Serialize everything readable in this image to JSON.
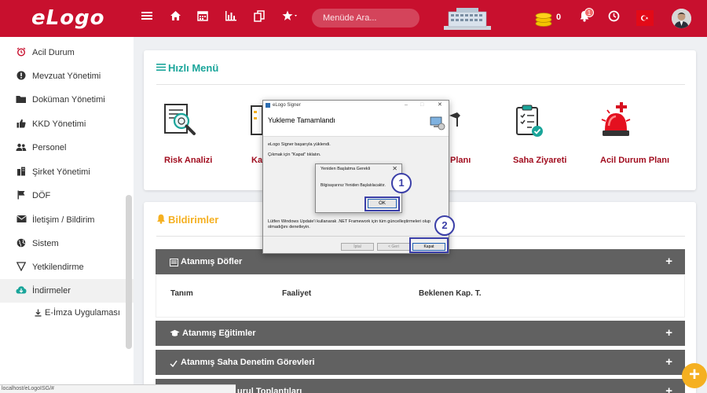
{
  "app": {
    "logo": "eLogo"
  },
  "topbar": {
    "search_placeholder": "Menüde Ara...",
    "coin_count": "0",
    "notification_badge": "1",
    "icons": [
      "menu-icon",
      "home-icon",
      "calendar-icon",
      "chart-icon",
      "copy-icon",
      "star-icon",
      "coins-icon",
      "bell-icon",
      "clock-icon",
      "flag-tr-icon",
      "user-avatar"
    ]
  },
  "sidebar": {
    "items": [
      {
        "label": "Acil Durum",
        "icon": "alarm-icon"
      },
      {
        "label": "Mevzuat Yönetimi",
        "icon": "exclamation-icon"
      },
      {
        "label": "Doküman Yönetimi",
        "icon": "folder-icon"
      },
      {
        "label": "KKD Yönetimi",
        "icon": "thumbs-up-icon"
      },
      {
        "label": "Personel",
        "icon": "users-icon"
      },
      {
        "label": "Şirket Yönetimi",
        "icon": "building-icon"
      },
      {
        "label": "DÖF",
        "icon": "flag-icon"
      },
      {
        "label": "İletişim / Bildirim",
        "icon": "envelope-icon"
      },
      {
        "label": "Sistem",
        "icon": "globe-icon"
      },
      {
        "label": "Yetkilendirme",
        "icon": "filter-icon"
      },
      {
        "label": "İndirmeler",
        "icon": "cloud-download-icon"
      }
    ],
    "subitem": "E-İmza Uygulaması"
  },
  "quick_menu": {
    "title": "Hızlı Menü",
    "items": [
      "Risk Analizi",
      "Kaz",
      "Planı",
      "Saha Ziyareti",
      "Acil Durum Planı"
    ]
  },
  "notifications": {
    "title": "Bildirimler",
    "sections": [
      {
        "label": "Atanmış Döfler"
      },
      {
        "label": "Atanmış Eğitimler"
      },
      {
        "label": "Atanmış Saha Denetim Görevleri"
      },
      {
        "label": "urul Toplantıları"
      }
    ],
    "table_headers": [
      "Tanım",
      "Faaliyet",
      "Beklenen Kap. T."
    ]
  },
  "installer": {
    "window_title": "eLogo Signer",
    "heading": "Yukleme Tamamlandı",
    "line1": "eLogo Signer başarıyla yüklendi.",
    "line2": "Çıkmak için \"Kapat\" tıklatın.",
    "footer": "Lütfen Windows Update'i kullanarak .NET Framework için tüm güncelleştirmeleri olup olmadığını denetleyin.",
    "btn_cancel": "İptal",
    "btn_back": "< Geri",
    "btn_close": "Kapat"
  },
  "restart_dialog": {
    "title": "Yeniden Başlatma Gerekli",
    "message": "Bilgisayarınız Yeniden Başlatılacaktır.",
    "ok": "OK"
  },
  "callouts": [
    "1",
    "2"
  ],
  "statusbar": {
    "url": "localhost/eLogoISG/#"
  },
  "colors": {
    "brand_red": "#c8102e",
    "accordion_gray": "#616161",
    "teal": "#1aa59a",
    "warning": "#f5b021",
    "annotation_blue": "#3b3fa8"
  }
}
